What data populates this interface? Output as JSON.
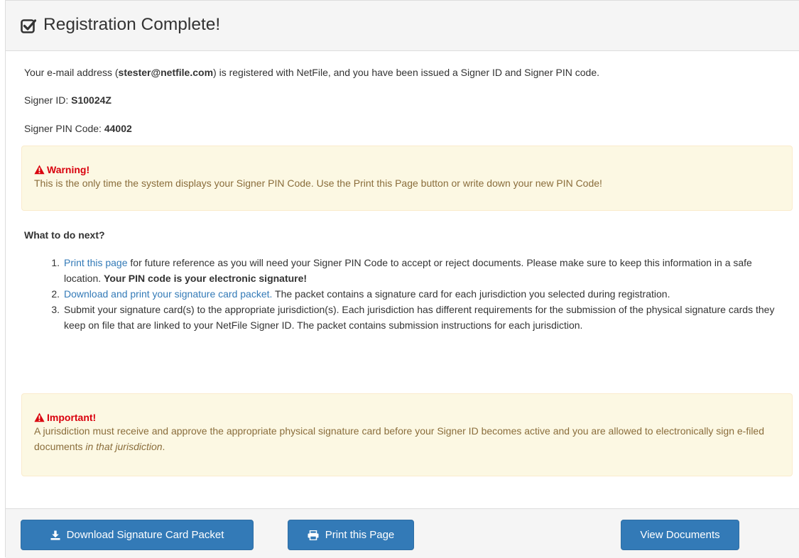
{
  "header": {
    "title": "Registration Complete!",
    "icon": "check-square-icon"
  },
  "intro": {
    "prefix": "Your e-mail address (",
    "email": "stester@netfile.com",
    "suffix": ") is registered with NetFile, and you have been issued a Signer ID and Signer PIN code."
  },
  "signer_id": {
    "label": "Signer ID: ",
    "value": "S10024Z"
  },
  "signer_pin": {
    "label": "Signer PIN Code: ",
    "value": "44002"
  },
  "warning": {
    "title": "Warning!",
    "body": "This is the only time the system displays your Signer PIN Code. Use the Print this Page button or write down your new PIN Code!"
  },
  "next": {
    "heading": "What to do next?",
    "steps": [
      {
        "num": "1.",
        "link": "Print this page",
        "text": " for future reference as you will need your Signer PIN Code to accept or reject documents. Please make sure to keep this information in a safe location. ",
        "bold": "Your PIN code is your electronic signature!"
      },
      {
        "num": "2.",
        "link": "Download and print your signature card packet.",
        "text": " The packet contains a signature card for each jurisdiction you selected during registration."
      },
      {
        "num": "3.",
        "text": "Submit your signature card(s) to the appropriate jurisdiction(s). Each jurisdiction has different requirements for the submission of the physical signature cards they keep on file that are linked to your NetFile Signer ID. The packet contains submission instructions for each jurisdiction."
      }
    ]
  },
  "important": {
    "title": "Important!",
    "body": "A jurisdiction must receive and approve the appropriate physical signature card before your Signer ID becomes active and you are allowed to electronically sign e-filed documents ",
    "italic": "in that jurisdiction",
    "end": "."
  },
  "footer": {
    "download_label": "Download Signature Card Packet",
    "print_label": "Print this Page",
    "view_label": "View Documents"
  },
  "colors": {
    "primary": "#337ab7",
    "warning_bg": "#fcf8e3",
    "warning_text": "#8a6d3b",
    "alert_title": "#d9000d",
    "link": "#337ab7"
  }
}
